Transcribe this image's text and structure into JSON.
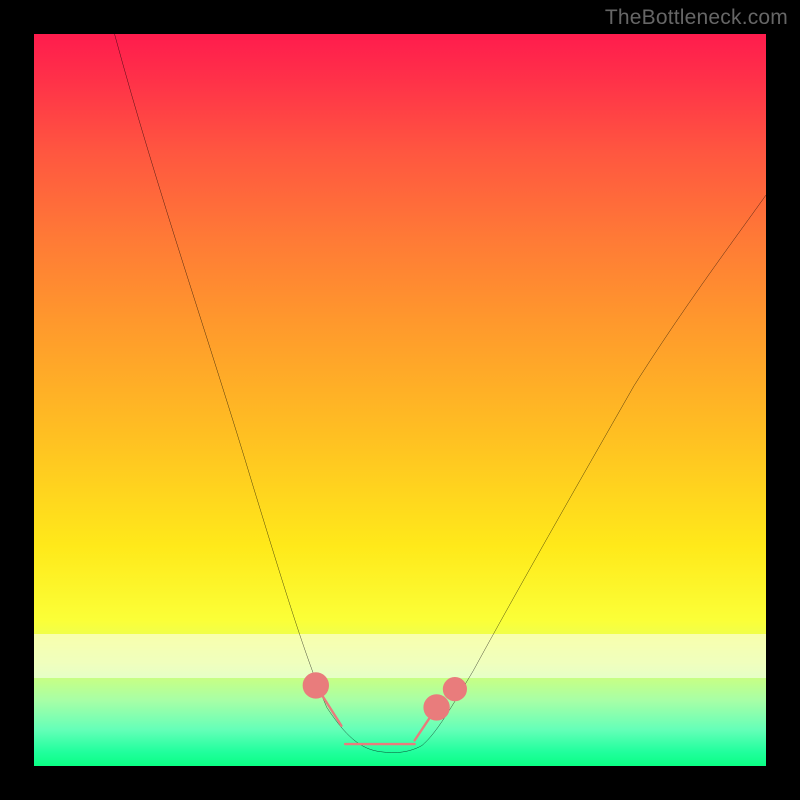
{
  "watermark": "TheBottleneck.com",
  "colors": {
    "frame": "#000000",
    "gradient_top": "#ff1c4d",
    "gradient_bottom": "#0aff84",
    "curve": "#000000",
    "markers": "#e97c7c",
    "watermark_text": "#666666"
  },
  "chart_data": {
    "type": "line",
    "title": "",
    "xlabel": "",
    "ylabel": "",
    "x_range": [
      0,
      100
    ],
    "y_range": [
      0,
      100
    ],
    "note": "Axes are unlabeled; values are estimated percentage positions along each axis (0 = left/bottom, 100 = right/top).",
    "series": [
      {
        "name": "bottleneck-curve",
        "x": [
          11,
          15,
          20,
          25,
          30,
          35,
          38,
          40,
          42,
          45,
          48,
          50,
          52,
          54,
          57,
          62,
          70,
          80,
          90,
          100
        ],
        "y": [
          100,
          84,
          66,
          49,
          33,
          19,
          12,
          8,
          5,
          3,
          2,
          2,
          2,
          4,
          8,
          16,
          30,
          48,
          64,
          78
        ]
      }
    ],
    "markers": [
      {
        "name": "left-marker",
        "x_range": [
          38,
          42
        ],
        "y_range": [
          4,
          10
        ]
      },
      {
        "name": "bottom-marker",
        "x_range": [
          42,
          52
        ],
        "y_range": [
          2,
          4
        ]
      },
      {
        "name": "right-marker",
        "x_range": [
          52,
          55
        ],
        "y_range": [
          4,
          9
        ]
      },
      {
        "name": "right-dot",
        "x": 57,
        "y": 9
      }
    ],
    "white_band_y": [
      12,
      18
    ]
  }
}
